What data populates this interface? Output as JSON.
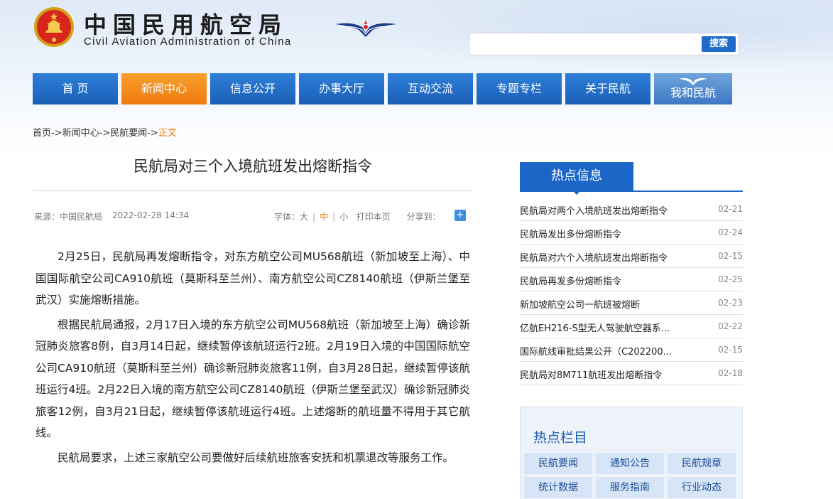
{
  "header": {
    "title_cn": "中国民用航空局",
    "title_en": "Civil Aviation Administration of China",
    "emblem_icon": "national-emblem-icon",
    "logo_icon": "caac-wings-logo-icon"
  },
  "search": {
    "placeholder": "",
    "button_label": "搜索"
  },
  "nav": {
    "items": [
      {
        "label": "首 页"
      },
      {
        "label": "新闻中心"
      },
      {
        "label": "信息公开"
      },
      {
        "label": "办事大厅"
      },
      {
        "label": "互动交流"
      },
      {
        "label": "专题专栏"
      },
      {
        "label": "关于民航"
      },
      {
        "label": "我和民航"
      }
    ],
    "active_color": "#F08A1C",
    "color": "#1F6CC8"
  },
  "breadcrumb": {
    "items": [
      "首页",
      "新闻中心",
      "民航要闻",
      "正文"
    ],
    "separator": "->"
  },
  "article": {
    "title": "民航局对三个入境航班发出熔断指令",
    "source": "来源：中国民航局",
    "date": "2022-02-28 14:34",
    "font_label": "字体：",
    "font_large": "大",
    "font_medium": "中",
    "font_small": "小",
    "print_label": "打印本页",
    "share_label": "分享到：",
    "paragraphs": [
      "2月25日，民航局再发熔断指令，对东方航空公司MU568航班（新加坡至上海）、中国国际航空公司CA910航班（莫斯科至兰州）、南方航空公司CZ8140航班（伊斯兰堡至武汉）实施熔断措施。",
      "根据民航局通报，2月17日入境的东方航空公司MU568航班（新加坡至上海）确诊新冠肺炎旅客8例，自3月14日起，继续暂停该航班运行2班。2月19日入境的中国国际航空公司CA910航班（莫斯科至兰州）确诊新冠肺炎旅客11例，自3月28日起，继续暂停该航班运行4班。2月22日入境的南方航空公司CZ8140航班（伊斯兰堡至武汉）确诊新冠肺炎旅客12例，自3月21日起，继续暂停该航班运行4班。上述熔断的航班量不得用于其它航线。",
      "民航局要求，上述三家航空公司要做好后续航班旅客安抚和机票退改等服务工作。"
    ]
  },
  "hot_info": {
    "header": "热点信息",
    "items": [
      {
        "title": "民航局对两个入境航班发出熔断指令",
        "date": "02-21"
      },
      {
        "title": "民航局发出多份熔断指令",
        "date": "02-24"
      },
      {
        "title": "民航局对六个入境航班发出熔断指令",
        "date": "02-15"
      },
      {
        "title": "民航局再发多份熔断指令",
        "date": "02-25"
      },
      {
        "title": "新加坡航空公司一航班被熔断",
        "date": "02-23"
      },
      {
        "title": "亿航EH216-S型无人驾驶航空器系...",
        "date": "02-22"
      },
      {
        "title": "国际航线审批结果公开（C202200...",
        "date": "02-15"
      },
      {
        "title": "民航局对8M711航班发出熔断指令",
        "date": "02-18"
      }
    ]
  },
  "hot_columns": {
    "title": "热点栏目",
    "items": [
      "民航要闻",
      "通知公告",
      "民航规章",
      "统计数据",
      "服务指南",
      "行业动态"
    ]
  }
}
